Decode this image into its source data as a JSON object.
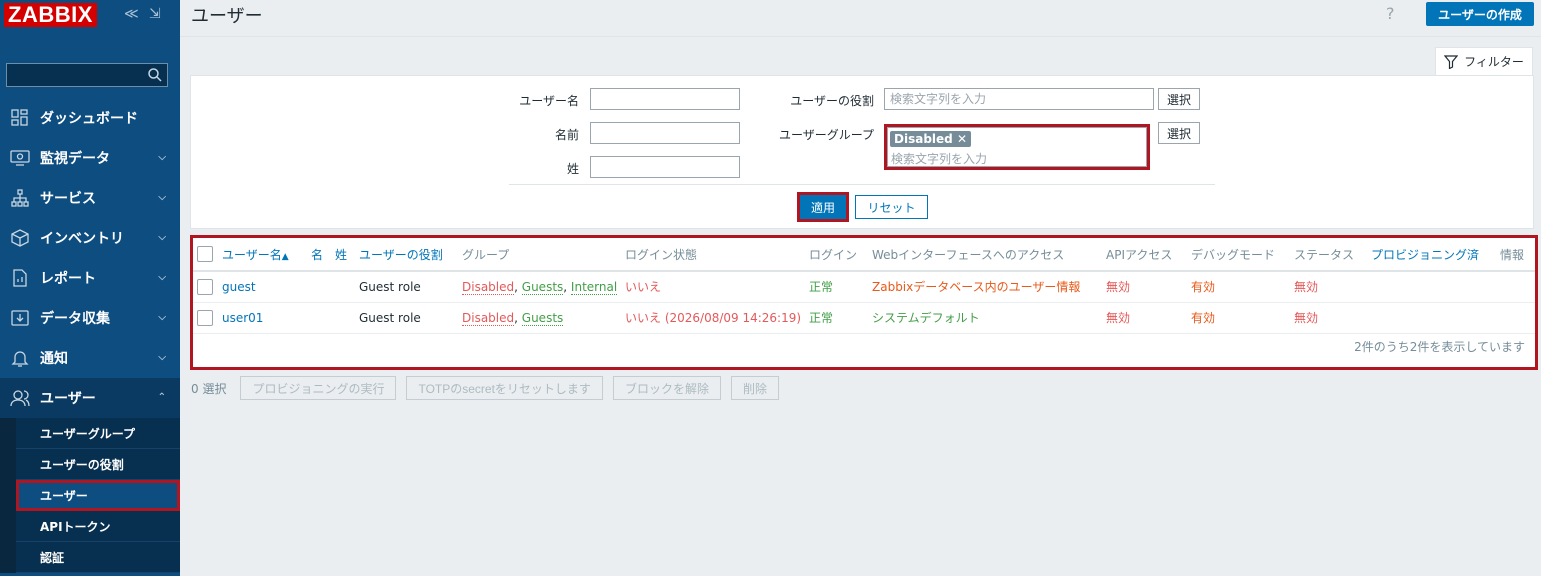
{
  "sidebar": {
    "logo": "ZABBIX",
    "collapse_glyph": "≪",
    "kiosk_glyph": "⇲",
    "menu": [
      {
        "label": "ダッシュボード",
        "icon": "dashboard-icon"
      },
      {
        "label": "監視データ",
        "icon": "monitoring-icon"
      },
      {
        "label": "サービス",
        "icon": "services-icon"
      },
      {
        "label": "インベントリ",
        "icon": "inventory-icon"
      },
      {
        "label": "レポート",
        "icon": "reports-icon"
      },
      {
        "label": "データ収集",
        "icon": "data-collection-icon"
      },
      {
        "label": "通知",
        "icon": "alerts-icon"
      },
      {
        "label": "ユーザー",
        "icon": "users-icon"
      }
    ],
    "submenu": [
      {
        "label": "ユーザーグループ"
      },
      {
        "label": "ユーザーの役割"
      },
      {
        "label": "ユーザー"
      },
      {
        "label": "APIトークン"
      },
      {
        "label": "認証"
      }
    ]
  },
  "header": {
    "title": "ユーザー",
    "help": "?",
    "create_button": "ユーザーの作成"
  },
  "filter": {
    "tab_label": "フィルター",
    "username_label": "ユーザー名",
    "name_label": "名前",
    "surname_label": "姓",
    "role_label": "ユーザーの役割",
    "role_placeholder": "検索文字列を入力",
    "group_label": "ユーザーグループ",
    "group_chip": "Disabled",
    "group_placeholder": "検索文字列を入力",
    "select_button": "選択",
    "apply_button": "適用",
    "reset_button": "リセット"
  },
  "table": {
    "headers": {
      "username": "ユーザー名",
      "sort_arrow": "▲",
      "name": "名",
      "surname": "姓",
      "role": "ユーザーの役割",
      "groups": "グループ",
      "login_status": "ログイン状態",
      "login": "ログイン",
      "frontend": "Webインターフェースへのアクセス",
      "api": "APIアクセス",
      "debug": "デバッグモード",
      "status": "ステータス",
      "provisioned": "プロビジョニング済",
      "info": "情報"
    },
    "rows": [
      {
        "username": "guest",
        "name": "",
        "surname": "",
        "role": "Guest role",
        "group1": "Disabled",
        "group2": "Guests",
        "group3": "Internal",
        "login_status": "いいえ",
        "login": "正常",
        "frontend": "Zabbixデータベース内のユーザー情報",
        "api": "無効",
        "debug": "有効",
        "status": "無効"
      },
      {
        "username": "user01",
        "name": "",
        "surname": "",
        "role": "Guest role",
        "group1": "Disabled",
        "group2": "Guests",
        "login_status": "いいえ (2026/08/09 14:26:19)",
        "login": "正常",
        "frontend": "システムデフォルト",
        "api": "無効",
        "debug": "有効",
        "status": "無効"
      }
    ],
    "separator": ", ",
    "footer": "2件のうち2件を表示しています"
  },
  "mass_actions": {
    "selected": "0 選択",
    "provision": "プロビジョニングの実行",
    "reset_totp": "TOTPのsecretをリセットします",
    "unblock": "ブロックを解除",
    "delete": "削除"
  },
  "colors": {
    "sidebar": "#0e4d80",
    "accent": "#0275b8",
    "highlight": "#b01622",
    "logo": "#d40000"
  }
}
